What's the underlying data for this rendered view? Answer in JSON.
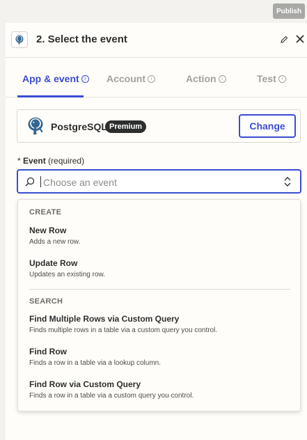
{
  "topbar": {
    "publish_label": "Publish"
  },
  "panel": {
    "title": "2. Select the event",
    "tabs": [
      {
        "label": "App & event"
      },
      {
        "label": "Account"
      },
      {
        "label": "Action"
      },
      {
        "label": "Test"
      }
    ],
    "info_glyph": "i"
  },
  "app": {
    "name": "PostgreSQL",
    "badge": "Premium",
    "change_label": "Change",
    "logo_icon": "postgresql-elephant-icon"
  },
  "event": {
    "label_prefix": "*",
    "label": "Event",
    "label_hint": "(required)",
    "placeholder": "Choose an event"
  },
  "dropdown": {
    "sections": [
      {
        "heading": "CREATE",
        "options": [
          {
            "title": "New Row",
            "description": "Adds a new row."
          },
          {
            "title": "Update Row",
            "description": "Updates an existing row."
          }
        ]
      },
      {
        "heading": "SEARCH",
        "options": [
          {
            "title": "Find Multiple Rows via Custom Query",
            "description": "Finds multiple rows in a table via a custom query you control."
          },
          {
            "title": "Find Row",
            "description": "Finds a row in a table via a lookup column."
          },
          {
            "title": "Find Row via Custom Query",
            "description": "Finds a row in a table via a custom query you control."
          }
        ]
      }
    ]
  },
  "colors": {
    "accent": "#3b4cd3",
    "badge_bg": "#2d2e2e",
    "panel_bg": "#fffdf9"
  }
}
